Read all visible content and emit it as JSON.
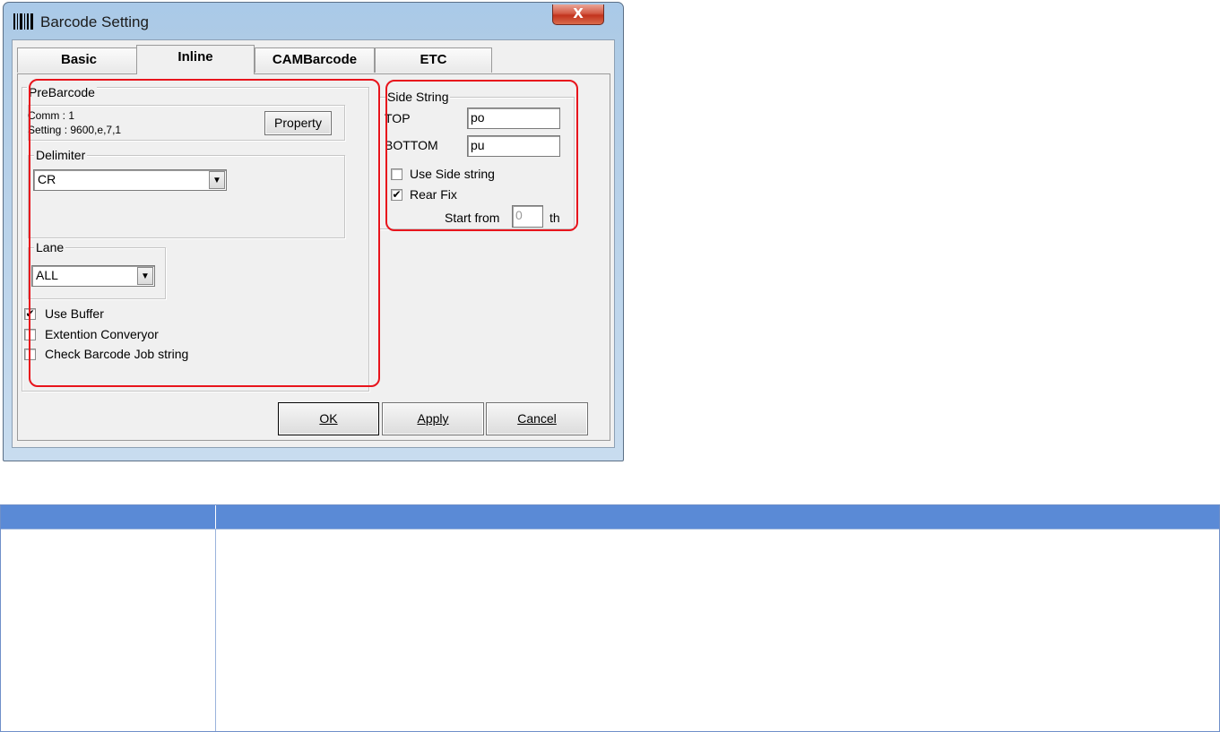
{
  "window": {
    "title": "Barcode Setting",
    "close_glyph": "X"
  },
  "tabs": [
    {
      "label": "Basic",
      "active": false
    },
    {
      "label": "Inline",
      "active": true
    },
    {
      "label": "CAMBarcode",
      "active": false
    },
    {
      "label": "ETC",
      "active": false
    }
  ],
  "prebarcode": {
    "group_label": "PreBarcode",
    "comm": "Comm : 1",
    "setting": "Setting : 9600,e,7,1",
    "property_button": "Property"
  },
  "delimiter": {
    "group_label": "Delimiter",
    "value": "CR"
  },
  "lane": {
    "group_label": "Lane",
    "value": "ALL"
  },
  "options": [
    {
      "label": "Use Buffer",
      "checked": true
    },
    {
      "label": "Extention Converyor",
      "checked": false
    },
    {
      "label": "Check Barcode Job string",
      "checked": false
    }
  ],
  "side_string": {
    "group_label": "Side String",
    "top_label": "TOP",
    "top_value": "po",
    "bottom_label": "BOTTOM",
    "bottom_value": "pu",
    "use_side_string": {
      "label": "Use Side string",
      "checked": false
    },
    "rear_fix": {
      "label": "Rear Fix",
      "checked": true
    },
    "start_from_label": "Start from",
    "start_from_value": "0",
    "start_from_suffix": "th"
  },
  "buttons": {
    "ok": "OK",
    "apply": "Apply",
    "cancel": "Cancel"
  },
  "check_glyph": "✔",
  "dropdown_glyph": "▼",
  "colors": {
    "annotation": "#e8141c",
    "table_header": "#5a8ad6"
  },
  "table": {
    "headers": [
      "",
      ""
    ],
    "rows": [
      [
        "",
        ""
      ]
    ]
  }
}
